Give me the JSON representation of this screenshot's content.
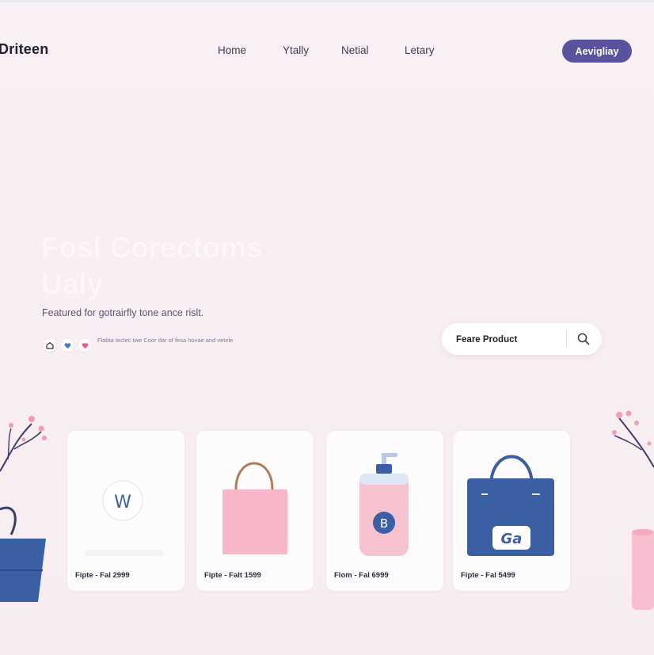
{
  "header": {
    "brand": "Driteen",
    "nav": [
      "Home",
      "Ytally",
      "Netial",
      "Letary"
    ],
    "cta_label": "Aevigliay"
  },
  "hero": {
    "title_line1": "Fosl Corectoms",
    "title_line2": "Ualy",
    "subtitle": "Featured for gotrairfly tone ance rislt.",
    "social_note": "Fiabta teclec twe Coor dar of fesa hovae and vetele"
  },
  "search": {
    "value": "Feare Product"
  },
  "products": [
    {
      "label": "Fipte - Fal 2999"
    },
    {
      "label": "Fipte - Falt 1599"
    },
    {
      "label": "Flom - Fal 6999"
    },
    {
      "label": "Fipte - Fal 5499"
    }
  ],
  "product_marks": {
    "card1": "W",
    "card3": "B",
    "card4": "Ga"
  },
  "colors": {
    "accent": "#5a519f",
    "pink": "#f4b3c6",
    "blue": "#3a5fa5",
    "brown": "#b07b57"
  }
}
